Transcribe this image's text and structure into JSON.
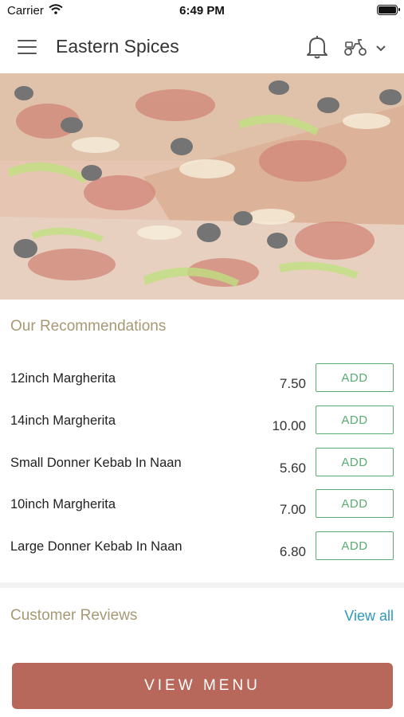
{
  "status_bar": {
    "carrier": "Carrier",
    "time": "6:49 PM"
  },
  "header": {
    "title": "Eastern Spices"
  },
  "recommendations": {
    "title": "Our Recommendations",
    "add_label": "ADD",
    "items": [
      {
        "name": "12inch Margherita",
        "price": "7.50"
      },
      {
        "name": "14inch Margherita",
        "price": "10.00"
      },
      {
        "name": "Small Donner Kebab In Naan",
        "price": "5.60"
      },
      {
        "name": "10inch Margherita",
        "price": "7.00"
      },
      {
        "name": "Large Donner Kebab In Naan",
        "price": "6.80"
      }
    ]
  },
  "reviews": {
    "title": "Customer Reviews",
    "view_all": "View all"
  },
  "cta": {
    "label": "VIEW MENU"
  },
  "colors": {
    "accent_green": "#5bac70",
    "link_blue": "#2e97c4",
    "cta": "#b7685a",
    "section_title": "#a89874"
  },
  "icons": [
    "menu-icon",
    "bell-icon",
    "scooter-icon",
    "chevron-down-icon",
    "wifi-icon",
    "battery-icon"
  ]
}
